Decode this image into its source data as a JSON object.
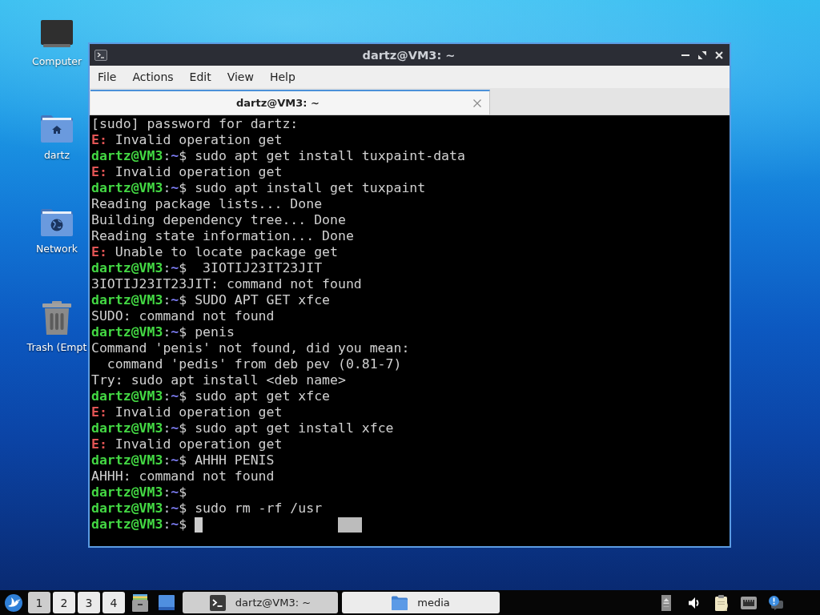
{
  "desktop_icons": [
    {
      "kind": "computer",
      "label": "Computer"
    },
    {
      "kind": "home",
      "label": "dartz"
    },
    {
      "kind": "network",
      "label": "Network"
    },
    {
      "kind": "trash",
      "label": "Trash (Empt"
    }
  ],
  "window": {
    "title": "dartz@VM3: ~",
    "menu": [
      "File",
      "Actions",
      "Edit",
      "View",
      "Help"
    ],
    "tabs": [
      {
        "label": "dartz@VM3: ~",
        "selected": true
      }
    ],
    "terminal": {
      "lines": [
        {
          "kind": "output",
          "text": "[sudo] password for dartz:"
        },
        {
          "kind": "error",
          "tag": "E:",
          "text": "Invalid operation get"
        },
        {
          "kind": "prompt",
          "user": "dartz@VM3",
          "separator": ":",
          "path": "~",
          "symbol": "$",
          "command": "sudo apt get install tuxpaint-data"
        },
        {
          "kind": "error",
          "tag": "E:",
          "text": "Invalid operation get"
        },
        {
          "kind": "prompt",
          "user": "dartz@VM3",
          "separator": ":",
          "path": "~",
          "symbol": "$",
          "command": "sudo apt install get tuxpaint"
        },
        {
          "kind": "output",
          "text": "Reading package lists... Done"
        },
        {
          "kind": "output",
          "text": "Building dependency tree... Done"
        },
        {
          "kind": "output",
          "text": "Reading state information... Done"
        },
        {
          "kind": "error",
          "tag": "E:",
          "text": "Unable to locate package get"
        },
        {
          "kind": "prompt",
          "user": "dartz@VM3",
          "separator": ":",
          "path": "~",
          "symbol": "$",
          "command": " 3IOTIJ23IT23JIT"
        },
        {
          "kind": "output",
          "text": "3IOTIJ23IT23JIT: command not found"
        },
        {
          "kind": "prompt",
          "user": "dartz@VM3",
          "separator": ":",
          "path": "~",
          "symbol": "$",
          "command": "SUDO APT GET xfce"
        },
        {
          "kind": "output",
          "text": "SUDO: command not found"
        },
        {
          "kind": "prompt",
          "user": "dartz@VM3",
          "separator": ":",
          "path": "~",
          "symbol": "$",
          "command": "penis"
        },
        {
          "kind": "output",
          "text": "Command 'penis' not found, did you mean:"
        },
        {
          "kind": "output",
          "text": "  command 'pedis' from deb pev (0.81-7)"
        },
        {
          "kind": "output",
          "text": "Try: sudo apt install <deb name>"
        },
        {
          "kind": "prompt",
          "user": "dartz@VM3",
          "separator": ":",
          "path": "~",
          "symbol": "$",
          "command": "sudo apt get xfce"
        },
        {
          "kind": "error",
          "tag": "E:",
          "text": "Invalid operation get"
        },
        {
          "kind": "prompt",
          "user": "dartz@VM3",
          "separator": ":",
          "path": "~",
          "symbol": "$",
          "command": "sudo apt get install xfce"
        },
        {
          "kind": "error",
          "tag": "E:",
          "text": "Invalid operation get"
        },
        {
          "kind": "prompt",
          "user": "dartz@VM3",
          "separator": ":",
          "path": "~",
          "symbol": "$",
          "command": "AHHH PENIS"
        },
        {
          "kind": "output",
          "text": "AHHH: command not found"
        },
        {
          "kind": "prompt",
          "user": "dartz@VM3",
          "separator": ":",
          "path": "~",
          "symbol": "$"
        },
        {
          "kind": "prompt",
          "user": "dartz@VM3",
          "separator": ":",
          "path": "~",
          "symbol": "$",
          "command": "sudo rm -rf /usr"
        },
        {
          "kind": "prompt",
          "user": "dartz@VM3",
          "separator": ":",
          "path": "~",
          "symbol": "$",
          "cursor": true,
          "selection": true
        }
      ]
    }
  },
  "taskbar": {
    "workspaces": [
      {
        "label": "1",
        "selected": true
      },
      {
        "label": "2",
        "selected": false
      },
      {
        "label": "3",
        "selected": false
      },
      {
        "label": "4",
        "selected": false
      }
    ],
    "tasks": [
      {
        "kind": "terminal",
        "label": "dartz@VM3: ~",
        "selected": true
      },
      {
        "kind": "folder",
        "label": "media",
        "selected": false
      }
    ]
  }
}
